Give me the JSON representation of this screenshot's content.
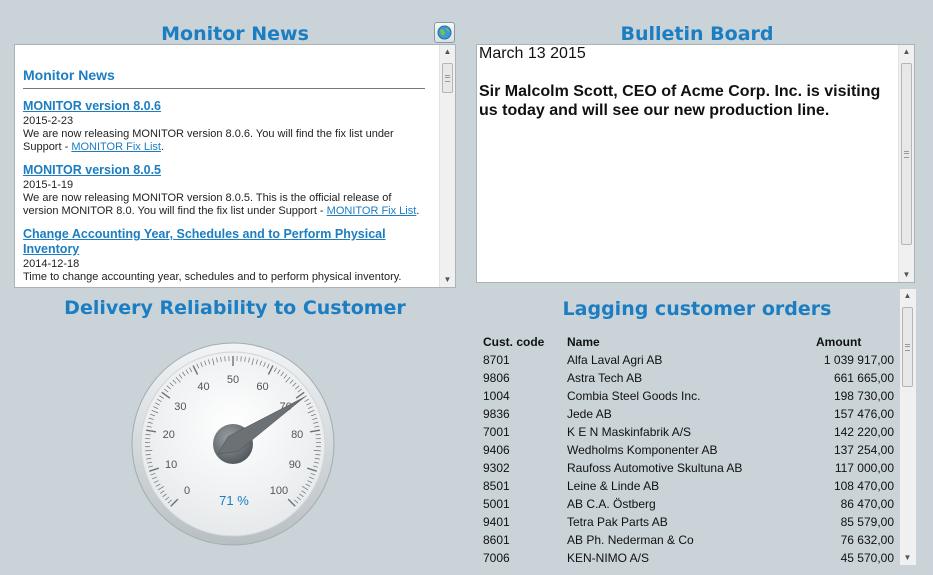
{
  "news": {
    "panel_title": "Monitor News",
    "header": "Monitor News",
    "items": [
      {
        "title": "MONITOR version 8.0.6",
        "date": "2015-2-23",
        "body": "We are now releasing MONITOR version 8.0.6. You will find the fix list under Support - ",
        "link": "MONITOR Fix List",
        "tail": "."
      },
      {
        "title": "MONITOR version 8.0.5",
        "date": "2015-1-19",
        "body": "We are now releasing MONITOR version 8.0.5. This is the official release of version MONITOR 8.0. You will find the fix list under Support - ",
        "link": "MONITOR Fix List",
        "tail": "."
      },
      {
        "title": "Change Accounting Year, Schedules and to Perform Physical Inventory",
        "date": "2014-12-18",
        "body": "Time to change accounting year, schedules and to perform physical inventory.",
        "link": "",
        "tail": ""
      }
    ]
  },
  "bulletin": {
    "panel_title": "Bulletin Board",
    "date": "March 13 2015",
    "message": "Sir Malcolm Scott, CEO of Acme Corp. Inc. is visiting us today and will see our new production line."
  },
  "gauge": {
    "panel_title": "Delivery Reliability to Customer",
    "value": 71,
    "value_label": "71 %",
    "min": 0,
    "max": 100,
    "tick_labels": [
      "0",
      "10",
      "20",
      "30",
      "40",
      "50",
      "60",
      "70",
      "80",
      "90",
      "100"
    ]
  },
  "orders": {
    "panel_title": "Lagging customer orders",
    "columns": [
      "Cust. code",
      "Name",
      "Amount"
    ],
    "rows": [
      [
        "8701",
        "Alfa Laval Agri AB",
        "1 039 917,00"
      ],
      [
        "9806",
        "Astra Tech AB",
        "661 665,00"
      ],
      [
        "1004",
        "Combia Steel Goods Inc.",
        "198 730,00"
      ],
      [
        "9836",
        "Jede AB",
        "157 476,00"
      ],
      [
        "7001",
        "K E N Maskinfabrik A/S",
        "142 220,00"
      ],
      [
        "9406",
        "Wedholms Komponenter AB",
        "137 254,00"
      ],
      [
        "9302",
        "Raufoss Automotive Skultuna AB",
        "117 000,00"
      ],
      [
        "8501",
        "Leine & Linde AB",
        "108 470,00"
      ],
      [
        "5001",
        "AB C.A. Östberg",
        "86 470,00"
      ],
      [
        "9401",
        "Tetra Pak Parts AB",
        "85 579,00"
      ],
      [
        "8601",
        "AB Ph. Nederman & Co",
        "76 632,00"
      ],
      [
        "7006",
        "KEN-NIMO A/S",
        "45 570,00"
      ]
    ]
  }
}
